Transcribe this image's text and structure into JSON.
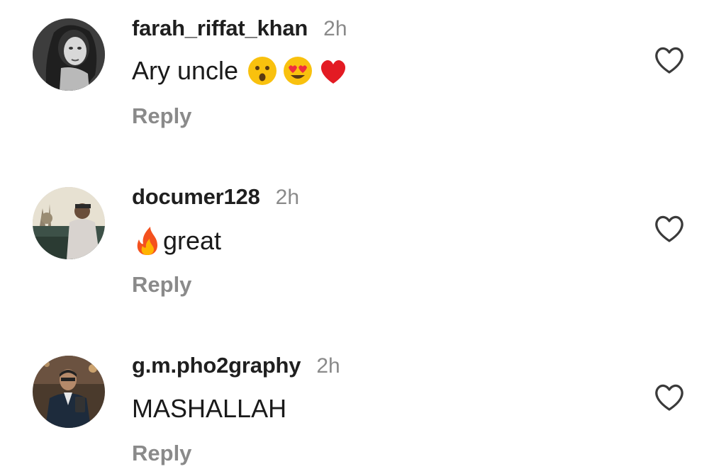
{
  "comments": [
    {
      "username": "farah_riffat_khan",
      "time": "2h",
      "text": "Ary uncle",
      "emojis": [
        "surprised-face-icon",
        "heart-eyes-face-icon",
        "red-heart-icon"
      ],
      "reply_label": "Reply"
    },
    {
      "username": "documer128",
      "time": "2h",
      "text": "great",
      "emojis": [
        "fire-icon"
      ],
      "reply_label": "Reply"
    },
    {
      "username": "g.m.pho2graphy",
      "time": "2h",
      "text": "MASHALLAH",
      "emojis": [],
      "reply_label": "Reply"
    }
  ],
  "colors": {
    "username": "#1f1f1f",
    "secondary": "#8a8a8a",
    "background": "#ffffff"
  }
}
